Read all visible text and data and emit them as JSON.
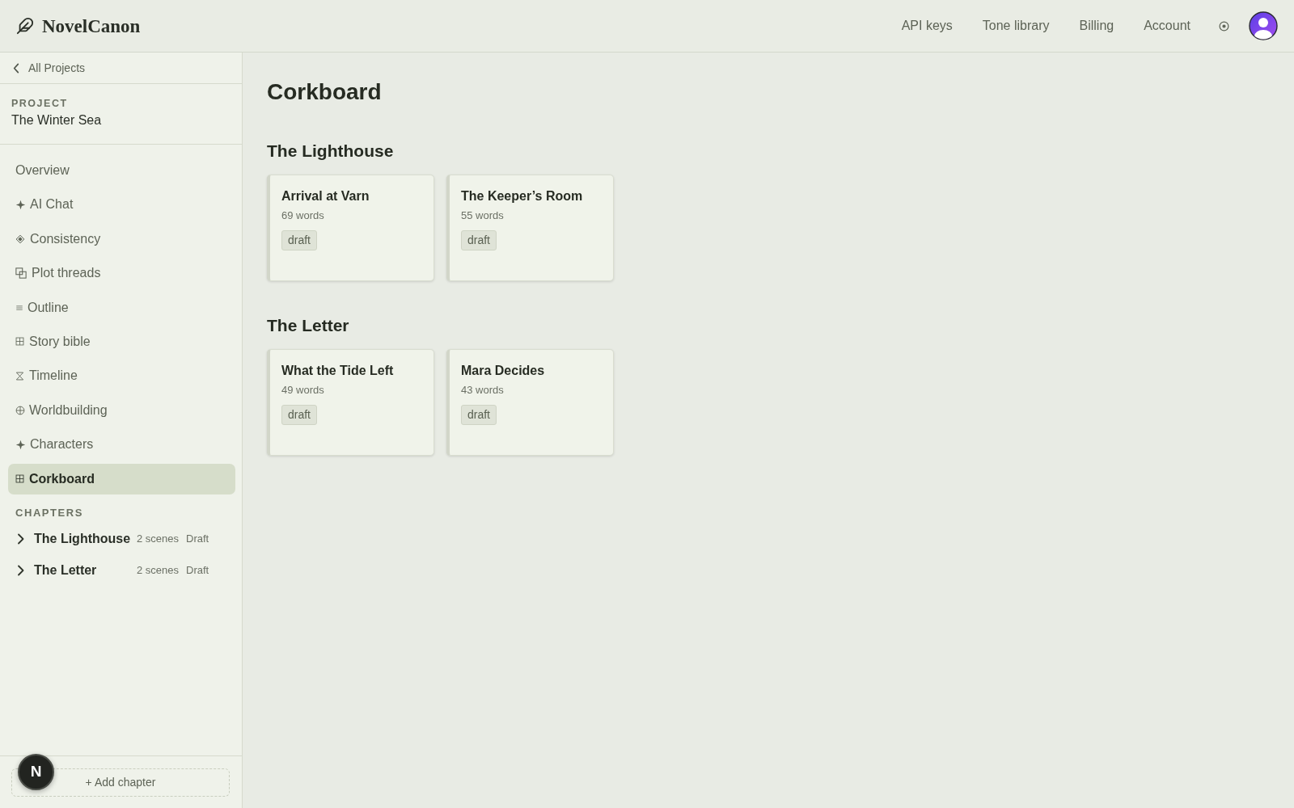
{
  "header": {
    "logo": "NovelCanon",
    "nav": [
      "API keys",
      "Tone library",
      "Billing",
      "Account"
    ]
  },
  "sidebar": {
    "back_link": "All Projects",
    "project_label": "PROJECT",
    "project_name": "The Winter Sea",
    "nav": [
      {
        "label": "Overview",
        "selected": false
      },
      {
        "label": "AI Chat",
        "selected": false
      },
      {
        "label": "Consistency",
        "selected": false
      },
      {
        "label": "Plot threads",
        "selected": false
      },
      {
        "label": "Outline",
        "selected": false
      },
      {
        "label": "Story bible",
        "selected": false
      },
      {
        "label": "Timeline",
        "selected": false
      },
      {
        "label": "Worldbuilding",
        "selected": false
      },
      {
        "label": "Characters",
        "selected": false
      },
      {
        "label": "Corkboard",
        "selected": true
      }
    ],
    "chapters_label": "CHAPTERS",
    "chapters": [
      {
        "title": "The Lighthouse",
        "scenes": "2 scenes",
        "status": "Draft",
        "expanded": false
      },
      {
        "title": "The Letter",
        "scenes": "2 scenes",
        "status": "Draft",
        "expanded": false
      }
    ],
    "add_chapter": "+ Add chapter"
  },
  "dev_indicator": "N",
  "main": {
    "title": "Corkboard",
    "groups": [
      {
        "title": "The Lighthouse",
        "cards": [
          {
            "title": "Arrival at Varn",
            "words": "69 words",
            "status": "draft"
          },
          {
            "title": "The Keeper’s Room",
            "words": "55 words",
            "status": "draft"
          }
        ]
      },
      {
        "title": "The Letter",
        "cards": [
          {
            "title": "What the Tide Left",
            "words": "49 words",
            "status": "draft"
          },
          {
            "title": "Mara Decides",
            "words": "43 words",
            "status": "draft"
          }
        ]
      }
    ]
  }
}
